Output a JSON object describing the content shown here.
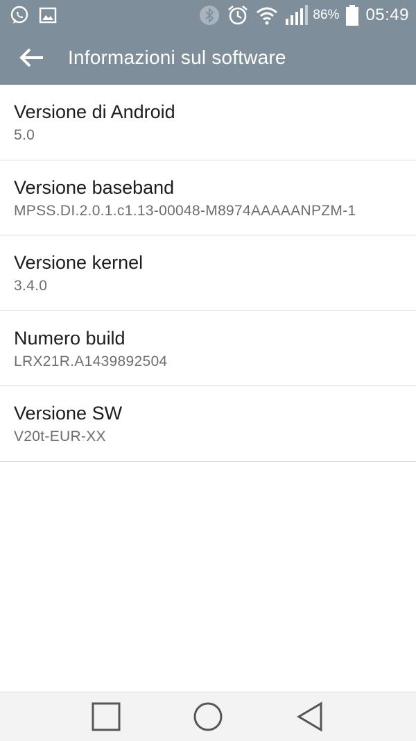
{
  "status_bar": {
    "icons_left": [
      "whatsapp-icon",
      "gallery-icon"
    ],
    "icons_right": [
      "bluetooth-icon",
      "alarm-icon",
      "wifi-icon",
      "signal-icon"
    ],
    "battery_percent": "86%",
    "time": "05:49"
  },
  "app_bar": {
    "title": "Informazioni sul software"
  },
  "items": [
    {
      "title": "Versione di Android",
      "value": "5.0"
    },
    {
      "title": "Versione baseband",
      "value": "MPSS.DI.2.0.1.c1.13-00048-M8974AAAAANPZM-1"
    },
    {
      "title": "Versione kernel",
      "value": "3.4.0"
    },
    {
      "title": "Numero build",
      "value": "LRX21R.A1439892504"
    },
    {
      "title": "Versione SW",
      "value": "V20t-EUR-XX"
    }
  ],
  "nav_bar": {
    "buttons": [
      "recents-icon",
      "home-icon",
      "back-icon"
    ]
  },
  "colors": {
    "header": "#7e8f9b",
    "divider": "#dcdcdc",
    "title_text": "#1c1c1c",
    "value_text": "#6d6d6d"
  }
}
